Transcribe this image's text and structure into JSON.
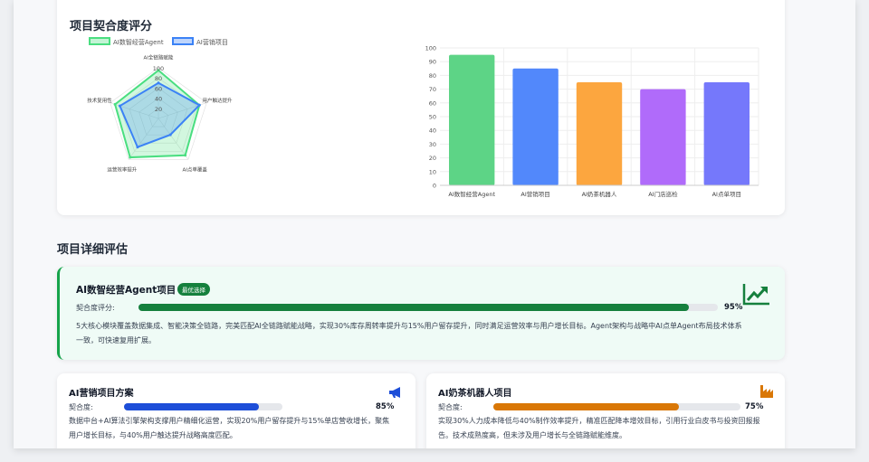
{
  "sections": {
    "score_title": "项目契合度评分",
    "detail_title": "项目详细评估"
  },
  "radar": {
    "type": "radar",
    "axes": [
      "AI全链路赋能",
      "用户触达提升",
      "AI点单覆盖",
      "运营效率提升",
      "技术复用性"
    ],
    "ticks": [
      "20",
      "40",
      "60",
      "80",
      "100"
    ],
    "max": 100,
    "series": [
      {
        "name": "AI数智经营Agent",
        "values": [
          95,
          85,
          90,
          95,
          90
        ],
        "color": "#4ade80"
      },
      {
        "name": "AI营销项目",
        "values": [
          70,
          85,
          40,
          70,
          80
        ],
        "color": "#3b82f6"
      }
    ],
    "legend_placement": "top"
  },
  "chart_data": {
    "type": "bar",
    "categories": [
      "AI数智经营Agent",
      "AI营销项目",
      "AI奶茶机器人",
      "AI门店巡检",
      "AI点单项目"
    ],
    "values": [
      95,
      85,
      75,
      70,
      75
    ],
    "colors": [
      "#5dd486",
      "#5288fb",
      "#fca63f",
      "#b06bfa",
      "#7578fb"
    ],
    "yticks": [
      "0",
      "10",
      "20",
      "30",
      "40",
      "50",
      "60",
      "70",
      "80",
      "90",
      "100"
    ],
    "ylim": [
      0,
      100
    ],
    "grid": true
  },
  "featured": {
    "title": "AI数智经营Agent项目",
    "badge": "最优选择",
    "score_label": "契合度评分:",
    "score": 95,
    "score_text": "95%",
    "color": "#15803d",
    "icon": "trending-up-icon",
    "desc": "5大核心模块覆盖数据集成、智能决策全链路，完美匹配AI全链路赋能战略，实现30%库存周转率提升与15%用户留存提升，同时满足运营效率与用户增长目标。Agent架构与战略中AI点单Agent布局技术体系一致，可快速复用扩展。"
  },
  "cards": [
    {
      "title": "AI营销项目方案",
      "score_label": "契合度:",
      "score": 85,
      "score_text": "85%",
      "color": "#1d4ed8",
      "icon": "megaphone-icon",
      "desc": "数据中台+AI算法引擎架构支撑用户精细化运营，实现20%用户留存提升与15%单店营收增长，聚焦用户增长目标，与40%用户触达提升战略高度匹配。"
    },
    {
      "title": "AI奶茶机器人项目",
      "score_label": "契合度:",
      "score": 75,
      "score_text": "75%",
      "color": "#d97706",
      "icon": "factory-icon",
      "desc": "实现30%人力成本降低与40%制作效率提升，精准匹配降本增效目标，引用行业白皮书与投资回报报告。技术成熟度高，但未涉及用户增长与全链路赋能维度。"
    }
  ]
}
